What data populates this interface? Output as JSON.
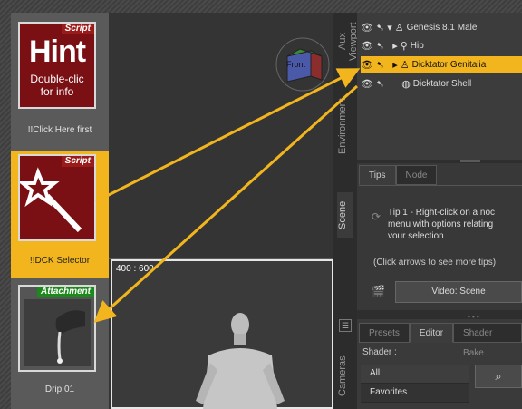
{
  "library": {
    "tiles": [
      {
        "tag": "Script",
        "big": "Hint",
        "sub1": "Double-clic",
        "sub2": "for info",
        "caption": "!!Click Here first"
      },
      {
        "tag": "Script",
        "caption": "!!DCK Selector"
      },
      {
        "tag": "Attachment",
        "caption": "Drip 01"
      }
    ]
  },
  "viewport": {
    "cube_label": "Front",
    "camera_label": "400 : 600"
  },
  "rail": {
    "tabs": [
      "Aux Viewport",
      "Environment",
      "Scene",
      "Cameras"
    ]
  },
  "scene_tree": {
    "rows": [
      {
        "label": "Genesis 8.1 Male"
      },
      {
        "label": "Hip"
      },
      {
        "label": "Dicktator Genitalia"
      },
      {
        "label": "Dicktator Shell"
      }
    ]
  },
  "tips_panel": {
    "tabs": [
      "Tips",
      "Node"
    ],
    "tip_line1": "Tip 1 - Right-click on a noc",
    "tip_line2": "menu with options relating",
    "tip_line3": "your selection",
    "more_tips": "(Click arrows to see more tips)",
    "video_button": "Video: Scene"
  },
  "surfaces_panel": {
    "tabs": [
      "Presets",
      "Editor",
      "Shader Bake"
    ],
    "shader_label": "Shader :",
    "list": [
      "All",
      "Favorites"
    ]
  },
  "colors": {
    "highlight": "#f2b51d",
    "tile_red": "#7a0f14",
    "arrow": "#f2b51d"
  }
}
